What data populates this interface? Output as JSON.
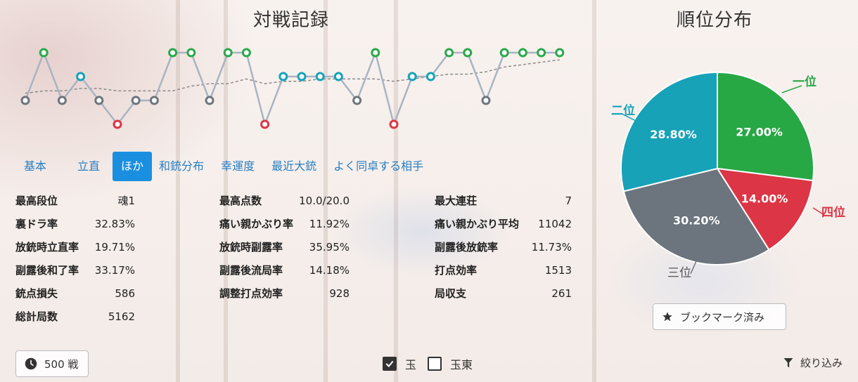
{
  "record": {
    "title": "対戦記録",
    "colors": {
      "1": "#2aa84a",
      "2": "#17a2b8",
      "3": "#6c757d",
      "4": "#dc3545",
      "line": "#a9b4c2",
      "trend": "#8a8a8a"
    },
    "ranks": [
      3,
      1,
      3,
      2,
      3,
      4,
      3,
      3,
      1,
      1,
      3,
      1,
      1,
      4,
      2,
      2,
      2,
      2,
      3,
      1,
      4,
      2,
      2,
      1,
      1,
      3,
      1,
      1,
      1,
      1
    ],
    "trend": [
      2.7,
      2.6,
      2.6,
      2.5,
      2.5,
      2.6,
      2.6,
      2.6,
      2.6,
      2.4,
      2.3,
      2.3,
      2.1,
      2.3,
      2.2,
      2.2,
      2.1,
      2.1,
      2.1,
      2.1,
      2.2,
      2.1,
      2.0,
      1.9,
      1.9,
      1.8,
      1.6,
      1.5,
      1.4,
      1.3
    ]
  },
  "tabs": [
    {
      "label": "基本",
      "active": false
    },
    {
      "label": "立直",
      "active": false
    },
    {
      "label": "ほか",
      "active": true
    },
    {
      "label": "和銃分布",
      "active": false
    },
    {
      "label": "幸運度",
      "active": false
    },
    {
      "label": "最近大銃",
      "active": false
    },
    {
      "label": "よく同卓する相手",
      "active": false
    }
  ],
  "stats": {
    "col1": [
      {
        "key": "最高段位",
        "value": "魂1"
      },
      {
        "key": "裏ドラ率",
        "value": "32.83%"
      },
      {
        "key": "放銃時立直率",
        "value": "19.71%"
      },
      {
        "key": "副露後和了率",
        "value": "33.17%"
      },
      {
        "key": "銃点損失",
        "value": "586"
      },
      {
        "key": "総計局数",
        "value": "5162"
      }
    ],
    "col2": [
      {
        "key": "最高点数",
        "value": "10.0/20.0"
      },
      {
        "key": "痛い親かぶり率",
        "value": "11.92%"
      },
      {
        "key": "放銃時副露率",
        "value": "35.95%"
      },
      {
        "key": "副露後流局率",
        "value": "14.18%"
      },
      {
        "key": "調整打点効率",
        "value": "928"
      }
    ],
    "col3": [
      {
        "key": "最大連荘",
        "value": "7"
      },
      {
        "key": "痛い親かぶり平均",
        "value": "11042"
      },
      {
        "key": "副露後放銃率",
        "value": "11.73%"
      },
      {
        "key": "打点効率",
        "value": "1513"
      },
      {
        "key": "局収支",
        "value": "261"
      }
    ]
  },
  "distribution": {
    "title": "順位分布",
    "chart_data": {
      "type": "pie",
      "slices": [
        {
          "label": "一位",
          "value": 27.0,
          "text": "27.00%",
          "color": "#28a745"
        },
        {
          "label": "四位",
          "value": 14.0,
          "text": "14.00%",
          "color": "#dc3545"
        },
        {
          "label": "三位",
          "value": 30.2,
          "text": "30.20%",
          "color": "#6c757d"
        },
        {
          "label": "二位",
          "value": 28.8,
          "text": "28.80%",
          "color": "#17a2b8"
        }
      ]
    }
  },
  "bookmark": {
    "label": "ブックマーク済み",
    "icon": "star-icon"
  },
  "games": {
    "label": "500 戦",
    "icon": "clock-icon"
  },
  "checks": [
    {
      "label": "玉",
      "checked": true
    },
    {
      "label": "玉東",
      "checked": false
    }
  ],
  "filter": {
    "label": "絞り込み",
    "icon": "filter-icon"
  }
}
